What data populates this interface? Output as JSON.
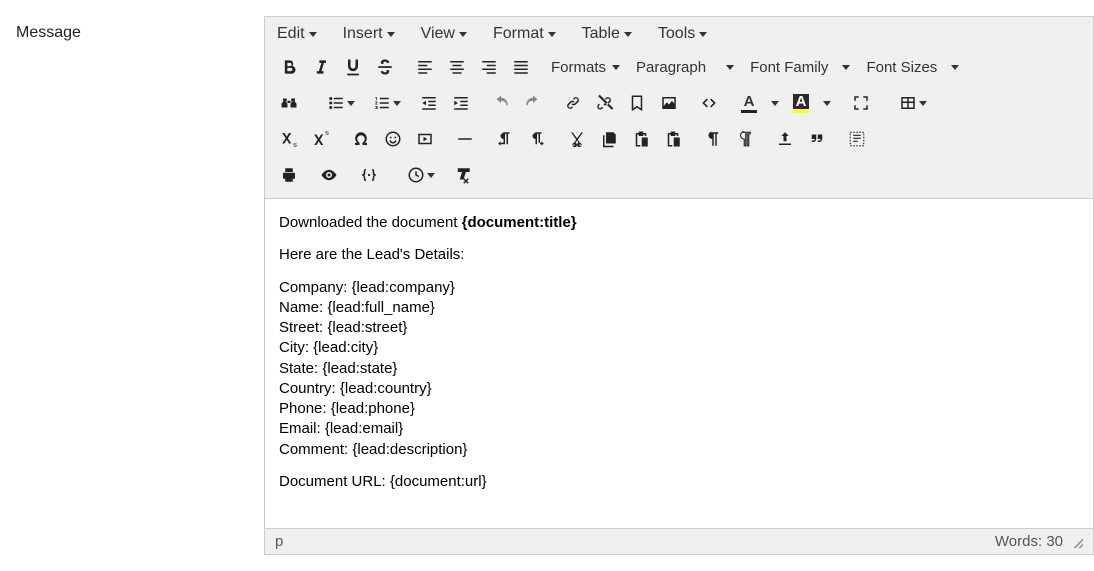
{
  "field_label": "Message",
  "menubar": {
    "edit": "Edit",
    "insert": "Insert",
    "view": "View",
    "format": "Format",
    "table": "Table",
    "tools": "Tools"
  },
  "toolbar": {
    "formats_label": "Formats",
    "paragraph_label": "Paragraph",
    "fontfamily_label": "Font Family",
    "fontsizes_label": "Font Sizes",
    "textcolor_letter": "A",
    "bgcolor_letter": "A"
  },
  "content": {
    "line1_prefix": "Downloaded the document ",
    "line1_bold": "{document:title}",
    "details_heading": "Here are the Lead's Details:",
    "fields": [
      "Company: {lead:company}",
      "Name: {lead:full_name}",
      "Street: {lead:street}",
      "City: {lead:city}",
      "State: {lead:state}",
      "Country: {lead:country}",
      "Phone: {lead:phone}",
      "Email: {lead:email}",
      "Comment: {lead:description}"
    ],
    "doc_url": "Document URL: {document:url}"
  },
  "statusbar": {
    "path": "p",
    "words_label": "Words: ",
    "word_count": "30"
  }
}
